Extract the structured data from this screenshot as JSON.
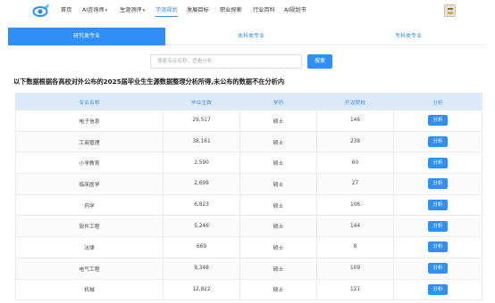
{
  "nav": {
    "items": [
      {
        "label": "首页",
        "has_dropdown": false,
        "active": false
      },
      {
        "label": "AI咨询师",
        "has_dropdown": true,
        "active": false
      },
      {
        "label": "生涯测评",
        "has_dropdown": true,
        "active": false
      },
      {
        "label": "学涯规划",
        "has_dropdown": false,
        "active": true
      },
      {
        "label": "发展目标",
        "has_dropdown": false,
        "active": false
      },
      {
        "label": "职业探索",
        "has_dropdown": false,
        "active": false
      },
      {
        "label": "行业百科",
        "has_dropdown": false,
        "active": false
      },
      {
        "label": "AI规划书",
        "has_dropdown": false,
        "active": false
      }
    ]
  },
  "tabs": [
    {
      "label": "研究类专业",
      "active": true
    },
    {
      "label": "本科类专业",
      "active": false
    },
    {
      "label": "专科类专业",
      "active": false
    }
  ],
  "search": {
    "placeholder": "搜索专业名称，查看分析",
    "button_label": "搜索"
  },
  "notice": "以下数据根据各高校对外公布的2025届毕业生生源数据整理分析所得,未公布的数据不在分析内",
  "table": {
    "headers": [
      "专业名称",
      "毕业生数",
      "学历",
      "开设院校",
      "分析"
    ],
    "action_label": "分析",
    "rows": [
      {
        "name": "电子信息",
        "graduates": "29,517",
        "degree": "硕士",
        "schools": "146"
      },
      {
        "name": "工商管理",
        "graduates": "38,161",
        "degree": "硕士",
        "schools": "238"
      },
      {
        "name": "小学教育",
        "graduates": "2,590",
        "degree": "硕士",
        "schools": "60"
      },
      {
        "name": "临床医学",
        "graduates": "2,699",
        "degree": "硕士",
        "schools": "27"
      },
      {
        "name": "药学",
        "graduates": "6,823",
        "degree": "硕士",
        "schools": "106"
      },
      {
        "name": "软件工程",
        "graduates": "5,246",
        "degree": "硕士",
        "schools": "144"
      },
      {
        "name": "法律",
        "graduates": "669",
        "degree": "硕士",
        "schools": "8"
      },
      {
        "name": "电气工程",
        "graduates": "9,348",
        "degree": "硕士",
        "schools": "109"
      },
      {
        "name": "机械",
        "graduates": "12,822",
        "degree": "硕士",
        "schools": "121"
      }
    ]
  },
  "colors": {
    "accent": "#2f8ff7",
    "header_bg": "#dbe9f8",
    "header_text": "#4a8fd6"
  }
}
